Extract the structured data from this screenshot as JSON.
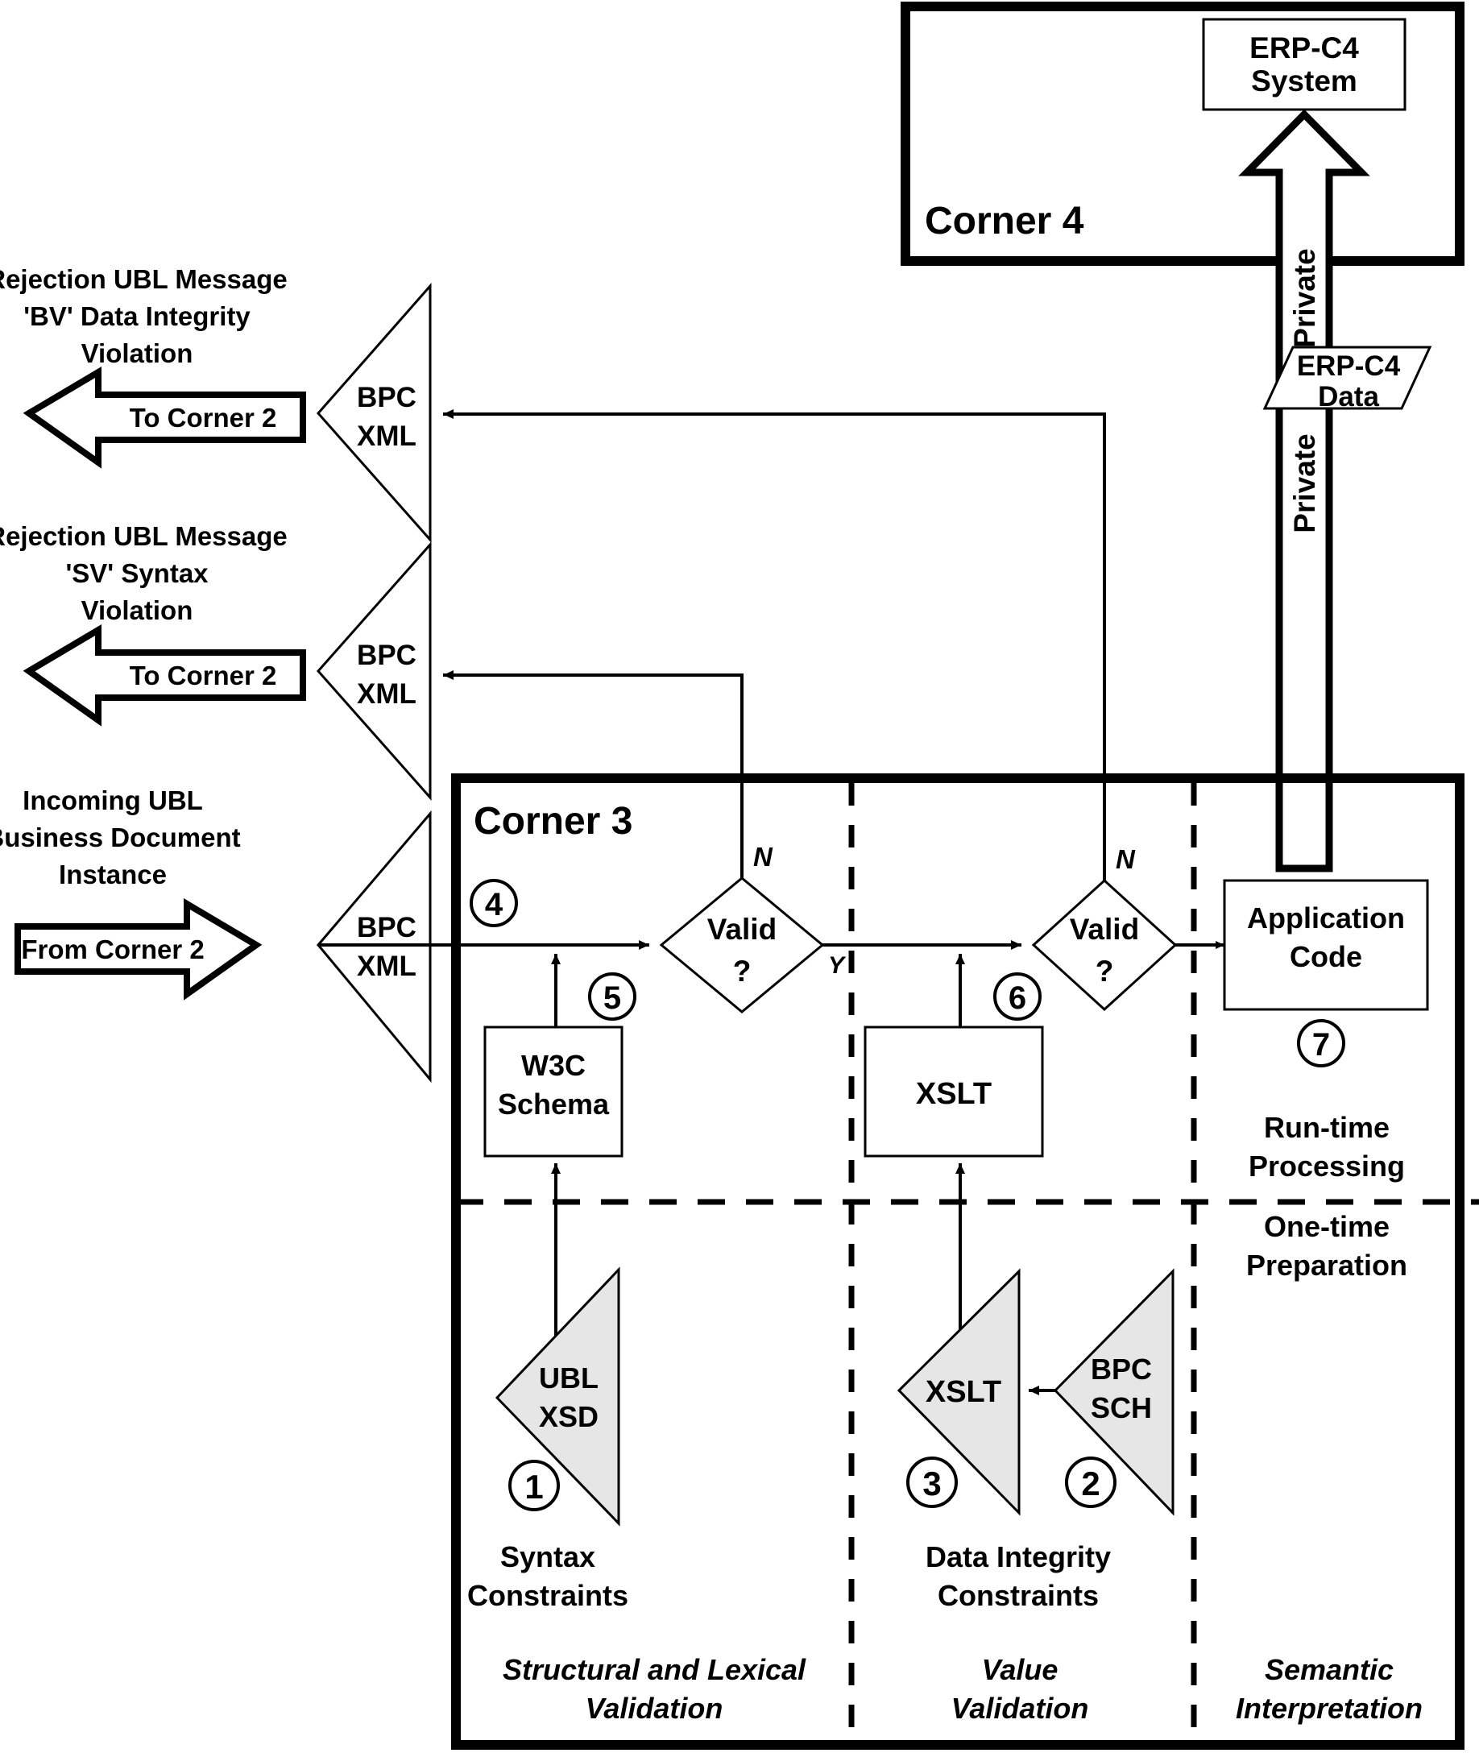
{
  "diagram": {
    "title_corner4": "Corner 4",
    "title_corner3": "Corner 3",
    "erp_system": {
      "line1": "ERP-C4",
      "line2": "System"
    },
    "erp_data": {
      "line1": "ERP-C4",
      "line2": "Data"
    },
    "private_upper": "Private",
    "private_lower": "Private",
    "messages": {
      "bv": {
        "line1": "Rejection UBL Message",
        "line2": "'BV' Data Integrity",
        "line3": "Violation",
        "arrow_label": "To Corner 2",
        "channel_line1": "BPC",
        "channel_line2": "XML"
      },
      "sv": {
        "line1": "Rejection UBL Message",
        "line2": "'SV' Syntax",
        "line3": "Violation",
        "arrow_label": "To Corner 2",
        "channel_line1": "BPC",
        "channel_line2": "XML"
      },
      "incoming": {
        "line1": "Incoming UBL",
        "line2": "Business Document",
        "line3": "Instance",
        "arrow_label": "From Corner 2",
        "channel_line1": "BPC",
        "channel_line2": "XML"
      }
    },
    "decisions": {
      "syntax": {
        "line1": "Valid",
        "line2": "?",
        "no": "N",
        "yes": "Y"
      },
      "value": {
        "line1": "Valid",
        "line2": "?",
        "no": "N",
        "yes": ""
      }
    },
    "boxes": {
      "w3c_schema": {
        "line1": "W3C",
        "line2": "Schema"
      },
      "xslt_runtime": {
        "line1": "XSLT"
      },
      "application_code": {
        "line1": "Application",
        "line2": "Code"
      }
    },
    "artifacts": {
      "ubl_xsd": {
        "line1": "UBL",
        "line2": "XSD"
      },
      "xslt_prep": {
        "line1": "XSLT"
      },
      "bpc_sch": {
        "line1": "BPC",
        "line2": "SCH"
      }
    },
    "step_numbers": {
      "one": "1",
      "two": "2",
      "three": "3",
      "four": "4",
      "five": "5",
      "six": "6",
      "seven": "7"
    },
    "constraint_labels": {
      "syntax": {
        "line1": "Syntax",
        "line2": "Constraints"
      },
      "data_integrity": {
        "line1": "Data Integrity",
        "line2": "Constraints"
      }
    },
    "phase_labels": {
      "runtime": {
        "line1": "Run-time",
        "line2": "Processing"
      },
      "onetime": {
        "line1": "One-time",
        "line2": "Preparation"
      }
    },
    "column_labels": {
      "structural": {
        "line1": "Structural and Lexical",
        "line2": "Validation"
      },
      "value": {
        "line1": "Value",
        "line2": "Validation"
      },
      "semantic": {
        "line1": "Semantic",
        "line2": "Interpretation"
      }
    },
    "colors": {
      "stroke": "#000000",
      "fill_white": "#ffffff",
      "fill_artifact": "#e6e6e6",
      "background": "#ffffff"
    }
  }
}
